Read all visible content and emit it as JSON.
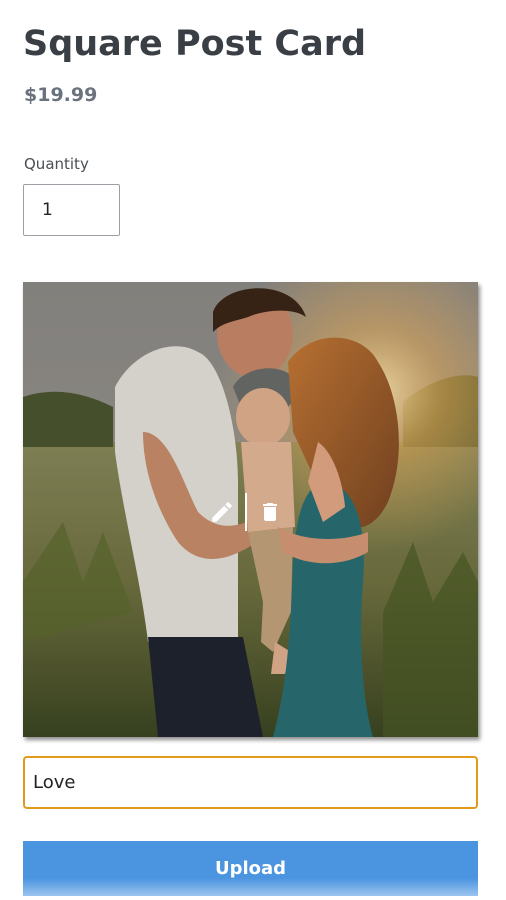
{
  "product": {
    "title": "Square Post Card",
    "price": "$19.99"
  },
  "quantity": {
    "label": "Quantity",
    "value": "1"
  },
  "photo": {
    "edit_icon": "pencil-icon",
    "delete_icon": "trash-icon"
  },
  "caption": {
    "value": "Love"
  },
  "upload": {
    "label": "Upload"
  },
  "colors": {
    "accent_button": "#4a94e0",
    "focus_border": "#e39a1c",
    "title": "#3a3f45",
    "price": "#6a737d"
  }
}
